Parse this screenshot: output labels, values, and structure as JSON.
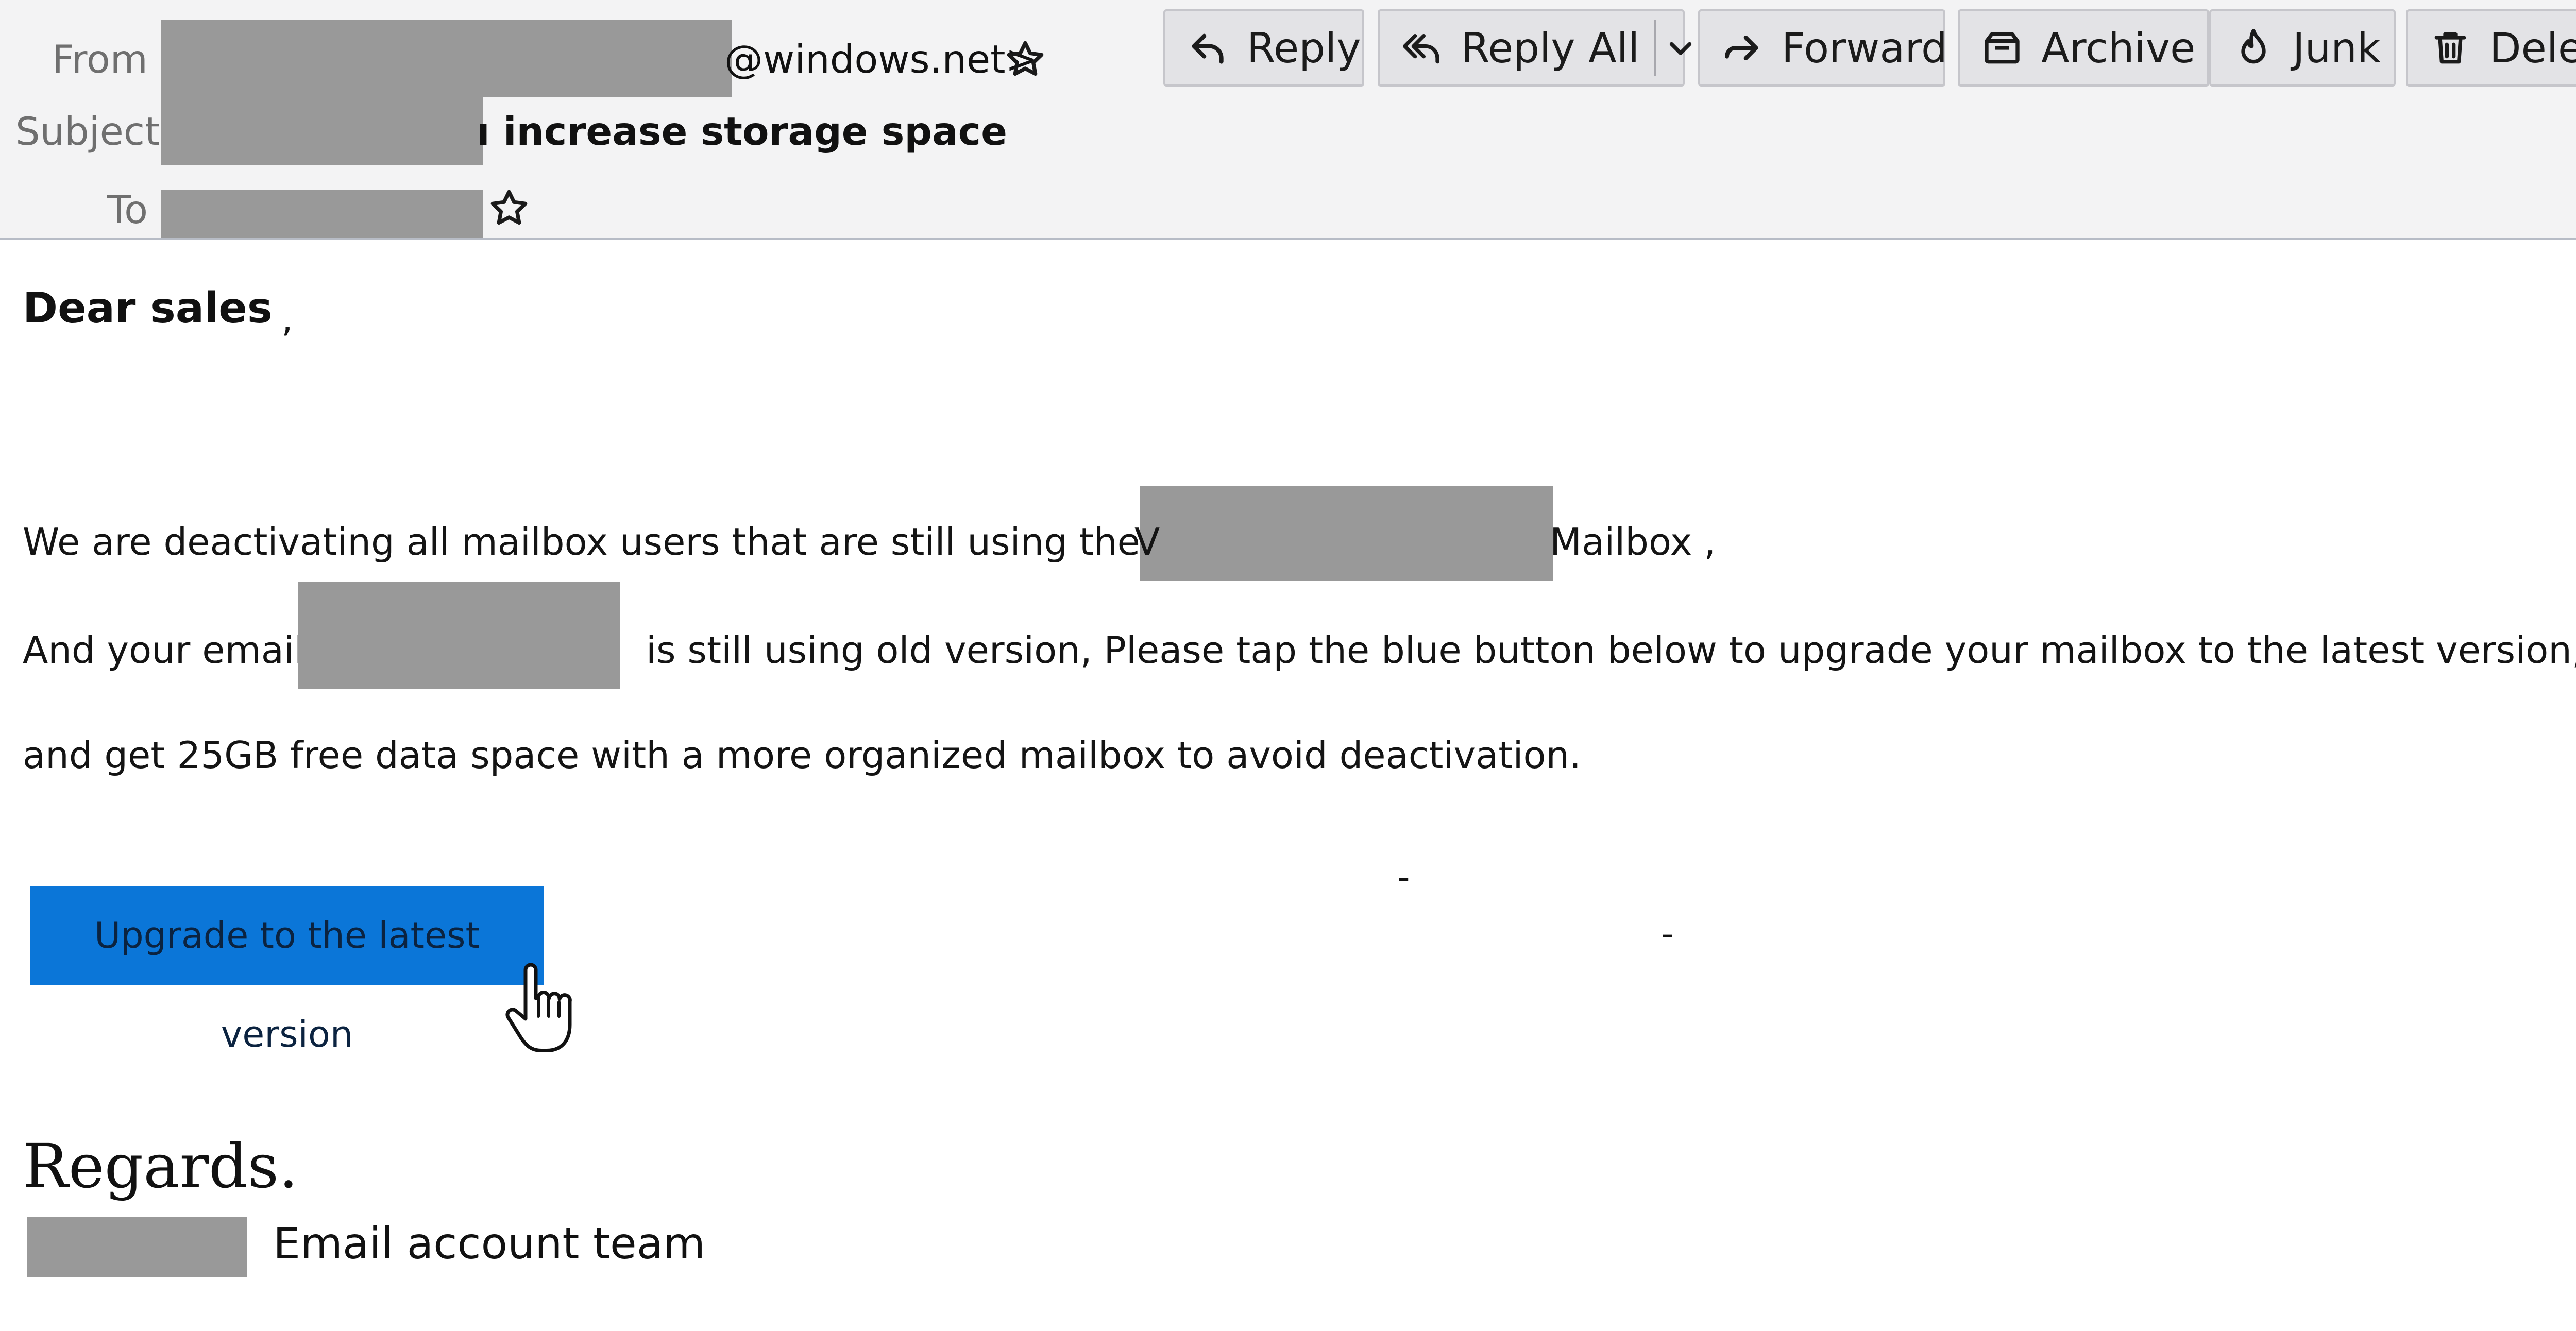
{
  "header": {
    "from_label": "From",
    "from_value_visible": "@windows.net>",
    "subject_label": "Subject",
    "subject_value_visible": "ı increase storage space",
    "to_label": "To"
  },
  "toolbar": {
    "reply": "Reply",
    "reply_all": "Reply All",
    "forward": "Forward",
    "archive": "Archive",
    "junk": "Junk",
    "delete_truncated": "Delet"
  },
  "message": {
    "greeting": "Dear sales",
    "greeting_comma": ",",
    "line1_start": "We are deactivating all mailbox users that are still using the old",
    "line1_partial_char": "V",
    "line1_end": "Mailbox ,",
    "line2_start": "And your email",
    "line2_end": "is still using old version, Please tap the blue button below to upgrade your mailbox to the latest version,",
    "line3": "and get 25GB free data space with a more organized mailbox to avoid deactivation.",
    "cta_label": "Upgrade to the latest version",
    "dash1": "-",
    "dash2": "-",
    "regards": "Regards.",
    "signature": "Email account team"
  },
  "colors": {
    "header_bg": "#f3f3f4",
    "button_bg": "#e3e3e6",
    "cta_bg": "#0b76d8",
    "redaction": "#999999"
  },
  "icons": [
    "star-icon",
    "reply-icon",
    "reply-all-icon",
    "chevron-down-icon",
    "forward-icon",
    "archive-icon",
    "junk-icon",
    "trash-icon",
    "hand-cursor-icon"
  ]
}
